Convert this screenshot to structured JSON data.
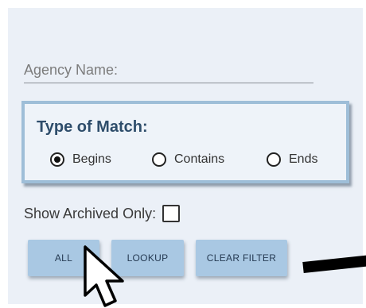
{
  "agency": {
    "placeholder": "Agency Name:",
    "value": ""
  },
  "match": {
    "title": "Type of Match:",
    "options": [
      {
        "label": "Begins",
        "selected": true
      },
      {
        "label": "Contains",
        "selected": false
      },
      {
        "label": "Ends",
        "selected": false
      }
    ]
  },
  "archived": {
    "label": "Show Archived Only:",
    "checked": false
  },
  "buttons": {
    "all": "ALL",
    "lookup": "LOOKUP",
    "clear": "CLEAR FILTER"
  },
  "colors": {
    "panel_bg": "#ebf0f7",
    "button_bg": "#a9c8e3",
    "match_border": "#9ebed8",
    "title_color": "#2e4d6b"
  },
  "icons": {
    "cursor": "mouse-pointer-icon"
  }
}
